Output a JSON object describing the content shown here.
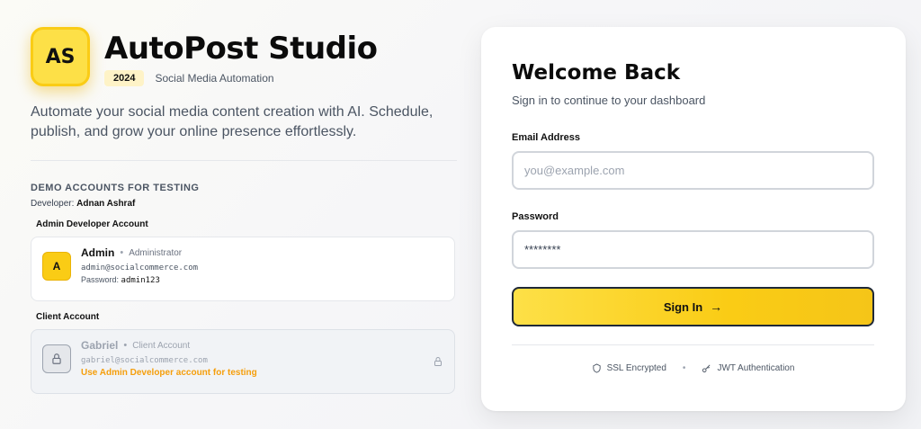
{
  "brand": {
    "logo_text": "AS",
    "title": "AutoPost Studio",
    "year": "2024",
    "tagline": "Social Media Automation",
    "description": "Automate your social media content creation with AI. Schedule, publish, and grow your online presence effortlessly."
  },
  "demo": {
    "title": "DEMO ACCOUNTS FOR TESTING",
    "developer_label": "Developer:",
    "developer_name": "Adnan Ashraf",
    "admin_section": "Admin Developer Account",
    "admin": {
      "avatar": "A",
      "name": "Admin",
      "role": "Administrator",
      "email": "admin@socialcommerce.com",
      "password_label": "Password:",
      "password": "admin123"
    },
    "client_section": "Client Account",
    "client": {
      "name": "Gabriel",
      "role": "Client Account",
      "email": "gabriel@socialcommerce.com",
      "note": "Use Admin Developer account for testing"
    }
  },
  "login": {
    "title": "Welcome Back",
    "subtitle": "Sign in to continue to your dashboard",
    "email_label": "Email Address",
    "email_placeholder": "you@example.com",
    "password_label": "Password",
    "password_value": "********",
    "signin_label": "Sign In",
    "signin_arrow": "→",
    "footer_ssl": "SSL Encrypted",
    "footer_sep": "•",
    "footer_jwt": "JWT Authentication"
  },
  "colors": {
    "accent": "#facc15",
    "warning": "#f59e0b"
  },
  "icons": {
    "lock": "lock-icon",
    "shield": "shield-icon",
    "key": "key-icon",
    "arrow": "arrow-right-icon"
  }
}
